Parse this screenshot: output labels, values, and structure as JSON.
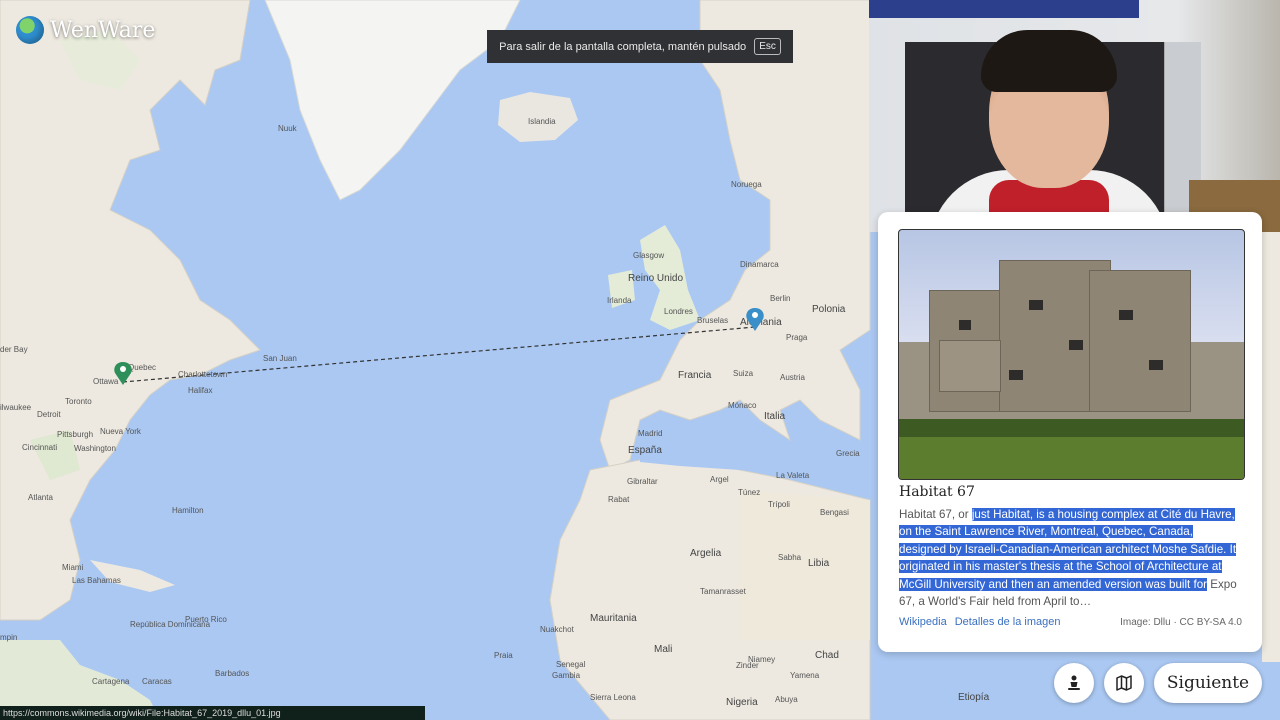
{
  "app": {
    "name": "WenWare"
  },
  "fullscreen_notice": {
    "text": "Para salir de la pantalla completa, mantén pulsado",
    "key": "Esc"
  },
  "map": {
    "labels": {
      "nuuk": "Nuuk",
      "islandia": "Islandia",
      "noruega": "Noruega",
      "reino_unido": "Reino Unido",
      "irlanda": "Irlanda",
      "glasgow": "Glasgow",
      "dinamarca": "Dinamarca",
      "londres": "Londres",
      "bruselas": "Bruselas",
      "berlin": "Berlin",
      "alemania": "Alemania",
      "polonia": "Polonia",
      "francia": "Francia",
      "praga": "Praga",
      "austria": "Austria",
      "suiza": "Suiza",
      "monaco": "Mónaco",
      "italia": "Italia",
      "madrid": "Madrid",
      "espana": "España",
      "grecia": "Grecia",
      "gibraltar": "Gibraltar",
      "rabat": "Rabat",
      "argel": "Argel",
      "tunez": "Túnez",
      "la_valeta": "La Valeta",
      "tripoli": "Trípoli",
      "bengasi": "Bengasi",
      "argelia": "Argelia",
      "libia": "Libia",
      "sabha": "Sabha",
      "tamanrasset": "Tamanrasset",
      "mauritania": "Mauritania",
      "nuakchot": "Nuakchot",
      "mali": "Mali",
      "niamey": "Niamey",
      "senegal": "Senegal",
      "zinder": "Zinder",
      "chad": "Chad",
      "nigeria": "Nigeria",
      "etiopia": "Etiopía",
      "yamena": "Yamena",
      "praia": "Praia",
      "gambia": "Gambia",
      "sierra_leona": "Sierra Leona",
      "abuya": "Abuya",
      "quebec": "Quebec",
      "ottawa": "Ottawa",
      "charlottetown": "Charlottetown",
      "san_juan": "San Juan",
      "halifax": "Halifax",
      "toronto": "Toronto",
      "detroit": "Detroit",
      "milwaukee": "ilwaukee",
      "pittsburgh": "Pittsburgh",
      "nueva_york": "Nueva York",
      "washington": "Washington",
      "cincinnati": "Cincinnati",
      "atlanta": "Atlanta",
      "hamilton": "Hamilton",
      "miami": "Miami",
      "las_bahamas": "Las Bahamas",
      "republica_dominicana": "República Dominicana",
      "puerto_rico": "Puerto Rico",
      "barbados": "Barbados",
      "cartagena": "Cartagena",
      "caracas": "Caracas",
      "dumpin": "mpin",
      "der_bay": "der Bay"
    }
  },
  "info_card": {
    "title": "Habitat 67",
    "desc_pre": "Habitat 67, or ",
    "desc_highlight": "just Habitat, is a housing complex at Cité du Havre, on the Saint Lawrence River, Montreal, Quebec, Canada, designed by Israeli-Canadian-American architect Moshe Safdie. It originated in his master's thesis at the School of Architecture at McGill University and then an amended version was built for",
    "desc_post": " Expo 67, a World's Fair held from April to…",
    "link_wikipedia": "Wikipedia",
    "link_details": "Detalles de la imagen",
    "credit": "Image: Dllu · CC BY-SA 4.0"
  },
  "buttons": {
    "next": "Siguiente",
    "pegman_icon": "person-icon",
    "map_icon": "map-icon"
  },
  "statusbar": {
    "url": "https://commons.wikimedia.org/wiki/File:Habitat_67_2019_dllu_01.jpg"
  },
  "colors": {
    "ocean": "#aac8f2",
    "land": "#f2efe9",
    "guess_pin": "#2e8f5a",
    "answer_pin": "#3b8fc9",
    "highlight": "#3367d6"
  }
}
